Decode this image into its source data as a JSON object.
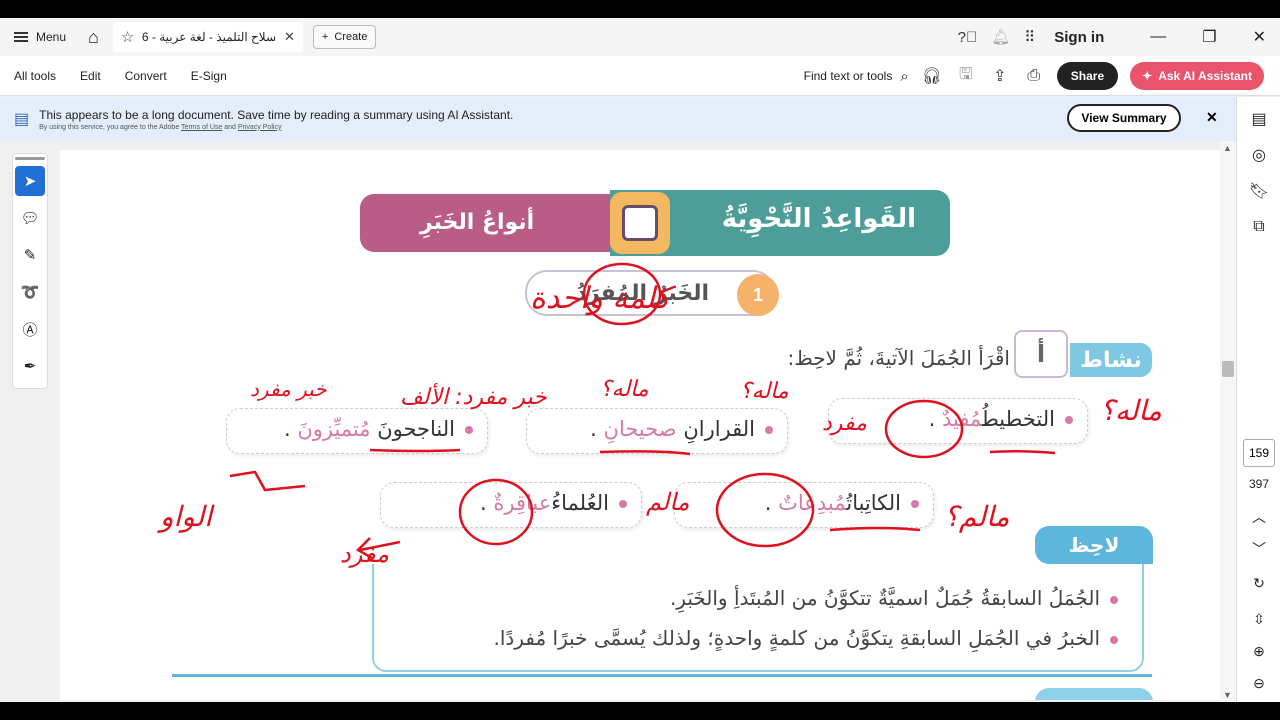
{
  "tabbar": {
    "menu_label": "Menu",
    "tab_title": "سلاح التلميذ - لغة عربية - 6 ا...",
    "create_label": "Create",
    "signin_label": "Sign in"
  },
  "toolbar": {
    "items": [
      "All tools",
      "Edit",
      "Convert",
      "E-Sign"
    ],
    "find_label": "Find text or tools",
    "share_label": "Share",
    "ai_label": "Ask AI Assistant"
  },
  "banner": {
    "main": "This appears to be a long document. Save time by reading a summary using AI Assistant.",
    "sub_prefix": "By using this service, you agree to the Adobe",
    "terms": "Terms of Use",
    "and": "and",
    "privacy": "Privacy Policy",
    "view_summary": "View Summary"
  },
  "navigation": {
    "current_page": "159",
    "total_pages": "397"
  },
  "worksheet": {
    "title": "القَواعِدُ النَّحْوِيَّةُ",
    "subtitle": "أنواعُ الخَبَرِ",
    "section_number": "1",
    "section_title": "الخَبَرُ المُفرَدُ",
    "activity_label": "نشاط",
    "activity_number": "أ",
    "instruction": "اقْرَأ الجُمَلَ الآتيةَ، ثُمَّ لاحِظ:",
    "sentences": [
      {
        "subject": "التخطيطُ",
        "predicate": "مُفيدٌ",
        "end": " ."
      },
      {
        "subject": "القرارانِ",
        "predicate": "صحيحانِ",
        "end": " ."
      },
      {
        "subject": "الناجحونَ",
        "predicate": "مُتميِّزونَ",
        "end": " ."
      },
      {
        "subject": "الكاتِباتُ",
        "predicate": "مُبدِعاتٌ",
        "end": " ."
      },
      {
        "subject": "العُلماءُ",
        "predicate": "عباقِرةٌ",
        "end": " ."
      }
    ],
    "note_label": "لاحِظ",
    "notes": [
      "الجُمَلُ السابقةُ جُمَلٌ اسميَّةٌ تتكوَّنُ من المُبتَدأِ والخَبَرِ.",
      "الخبرُ في الجُمَلِ السابقةِ يتكوَّنُ من كلمةٍ واحدةٍ؛ ولذلك يُسمَّى خبرًا مُفردًا."
    ]
  },
  "annotations": {
    "color": "#e0101e",
    "texts": [
      "كلمة واحدة",
      "خبر مفرد",
      "خبر مفرد: الألف",
      "ماله؟",
      "ماله؟",
      "مفرد",
      "ماله؟",
      "مالم",
      "مالم؟",
      "الواو",
      "مفرد"
    ]
  }
}
